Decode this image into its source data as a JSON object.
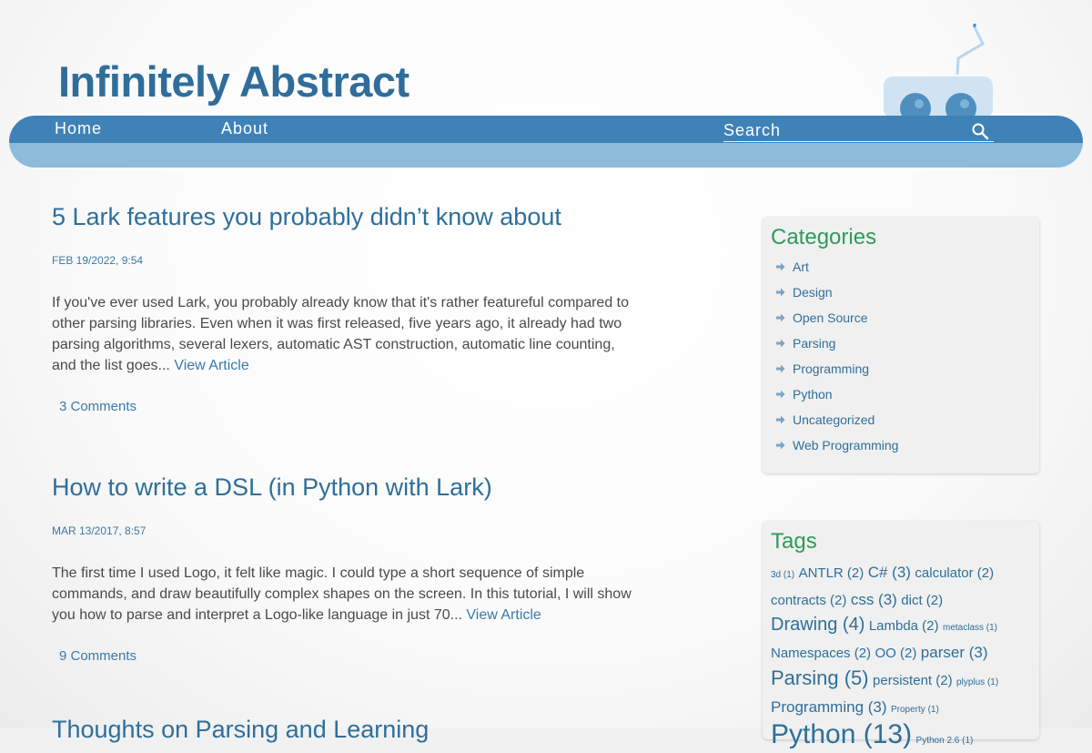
{
  "site": {
    "title": "Infinitely Abstract"
  },
  "nav": {
    "items": [
      {
        "label": "Home"
      },
      {
        "label": "About"
      }
    ],
    "search": {
      "placeholder": "Search",
      "value": ""
    }
  },
  "posts": [
    {
      "title": "5 Lark features you probably didn’t know about",
      "date": "FEB 19/2022, 9:54",
      "excerpt": "If you've ever used Lark, you probably already know that it's rather featureful compared to other parsing libraries. Even when it was first released, five years ago, it already had two parsing algorithms, several lexers, automatic AST construction, automatic line counting, and the list goes...",
      "read_more": "View Article",
      "comments": "3 Comments"
    },
    {
      "title": "How to write a DSL (in Python with Lark)",
      "date": "MAR 13/2017, 8:57",
      "excerpt": "The first time I used Logo, it felt like magic. I could type a short sequence of simple commands, and draw beautifully complex shapes on the screen. In this tutorial, I will show you how to parse and interpret a Logo-like language in just 70...",
      "read_more": "View Article",
      "comments": "9 Comments"
    },
    {
      "title": "Thoughts on Parsing and Learning",
      "partially_visible": true
    }
  ],
  "sidebar": {
    "categories": {
      "title": "Categories",
      "items": [
        {
          "label": "Art"
        },
        {
          "label": "Design"
        },
        {
          "label": "Open Source"
        },
        {
          "label": "Parsing"
        },
        {
          "label": "Programming"
        },
        {
          "label": "Python"
        },
        {
          "label": "Uncategorized"
        },
        {
          "label": "Web Programming"
        }
      ]
    },
    "tags": {
      "title": "Tags",
      "items": [
        {
          "label": "3d (1)",
          "count": 1
        },
        {
          "label": "ANTLR (2)",
          "count": 2
        },
        {
          "label": "C# (3)",
          "count": 3
        },
        {
          "label": "calculator (2)",
          "count": 2
        },
        {
          "label": "contracts (2)",
          "count": 2
        },
        {
          "label": "css (3)",
          "count": 3
        },
        {
          "label": "dict (2)",
          "count": 2
        },
        {
          "label": "Drawing (4)",
          "count": 4
        },
        {
          "label": "Lambda (2)",
          "count": 2
        },
        {
          "label": "metaclass (1)",
          "count": 1
        },
        {
          "label": "Namespaces (2)",
          "count": 2
        },
        {
          "label": "OO (2)",
          "count": 2
        },
        {
          "label": "parser (3)",
          "count": 3
        },
        {
          "label": "Parsing (5)",
          "count": 5
        },
        {
          "label": "persistent (2)",
          "count": 2
        },
        {
          "label": "plyplus (1)",
          "count": 1
        },
        {
          "label": "Programming (3)",
          "count": 3
        },
        {
          "label": "Property (1)",
          "count": 1
        },
        {
          "label": "Python (13)",
          "count": 13
        },
        {
          "label": "Python 2.6 (1)",
          "count": 1
        }
      ]
    }
  },
  "colors": {
    "title": "#2f6d9b",
    "link": "#2e6f9a",
    "nav_dark": "#3f82b8",
    "nav_light": "#8cbbdc",
    "widget_heading": "#2f9a5a"
  }
}
